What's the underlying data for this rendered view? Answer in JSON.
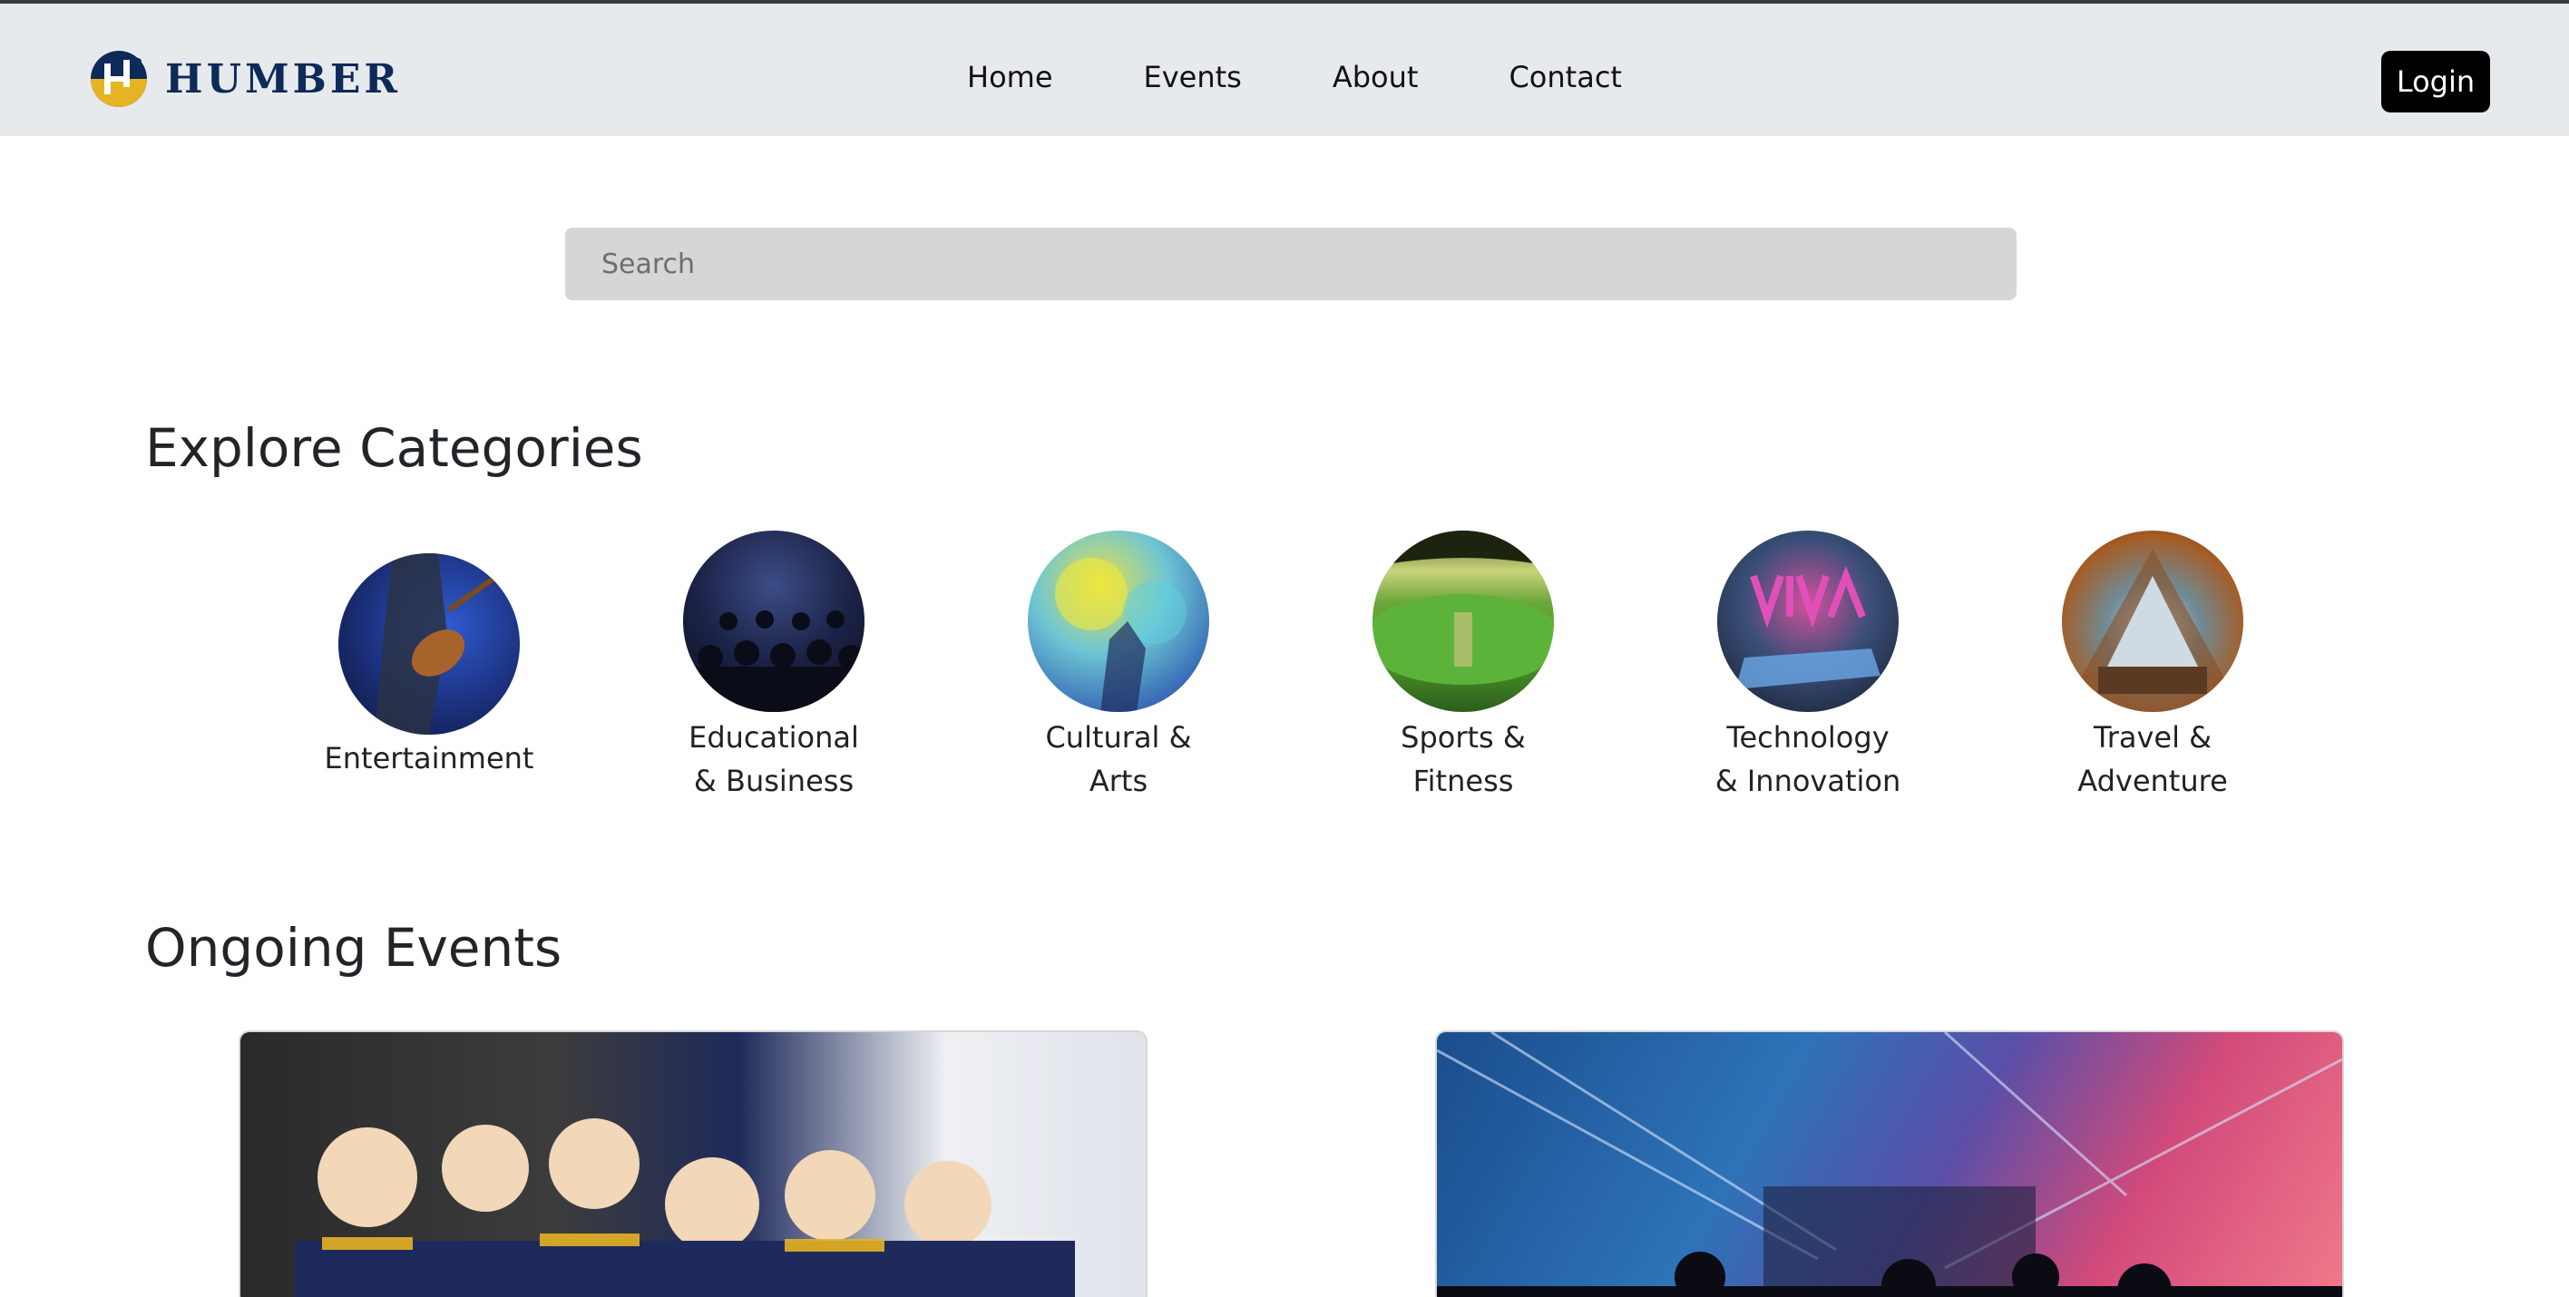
{
  "brand": {
    "name": "HUMBER",
    "colors": {
      "primary": "#0d2a59",
      "accent": "#e6b324"
    }
  },
  "nav": {
    "links": [
      {
        "label": "Home"
      },
      {
        "label": "Events"
      },
      {
        "label": "About"
      },
      {
        "label": "Contact"
      }
    ],
    "login_label": "Login"
  },
  "search": {
    "placeholder": "Search",
    "value": ""
  },
  "explore": {
    "title": "Explore Categories",
    "categories": [
      {
        "label": "Entertainment",
        "icon": "guitarist-photo"
      },
      {
        "label": "Educational\n& Business",
        "icon": "audience-photo"
      },
      {
        "label": "Cultural &\nArts",
        "icon": "color-festival-photo"
      },
      {
        "label": "Sports &\nFitness",
        "icon": "stadium-photo"
      },
      {
        "label": "Technology\n& Innovation",
        "icon": "tech-expo-photo"
      },
      {
        "label": "Travel &\nAdventure",
        "icon": "tent-photo"
      }
    ]
  },
  "ongoing": {
    "title": "Ongoing Events",
    "events": [
      {
        "image": "graduation-photo"
      },
      {
        "image": "concert-photo"
      }
    ]
  }
}
